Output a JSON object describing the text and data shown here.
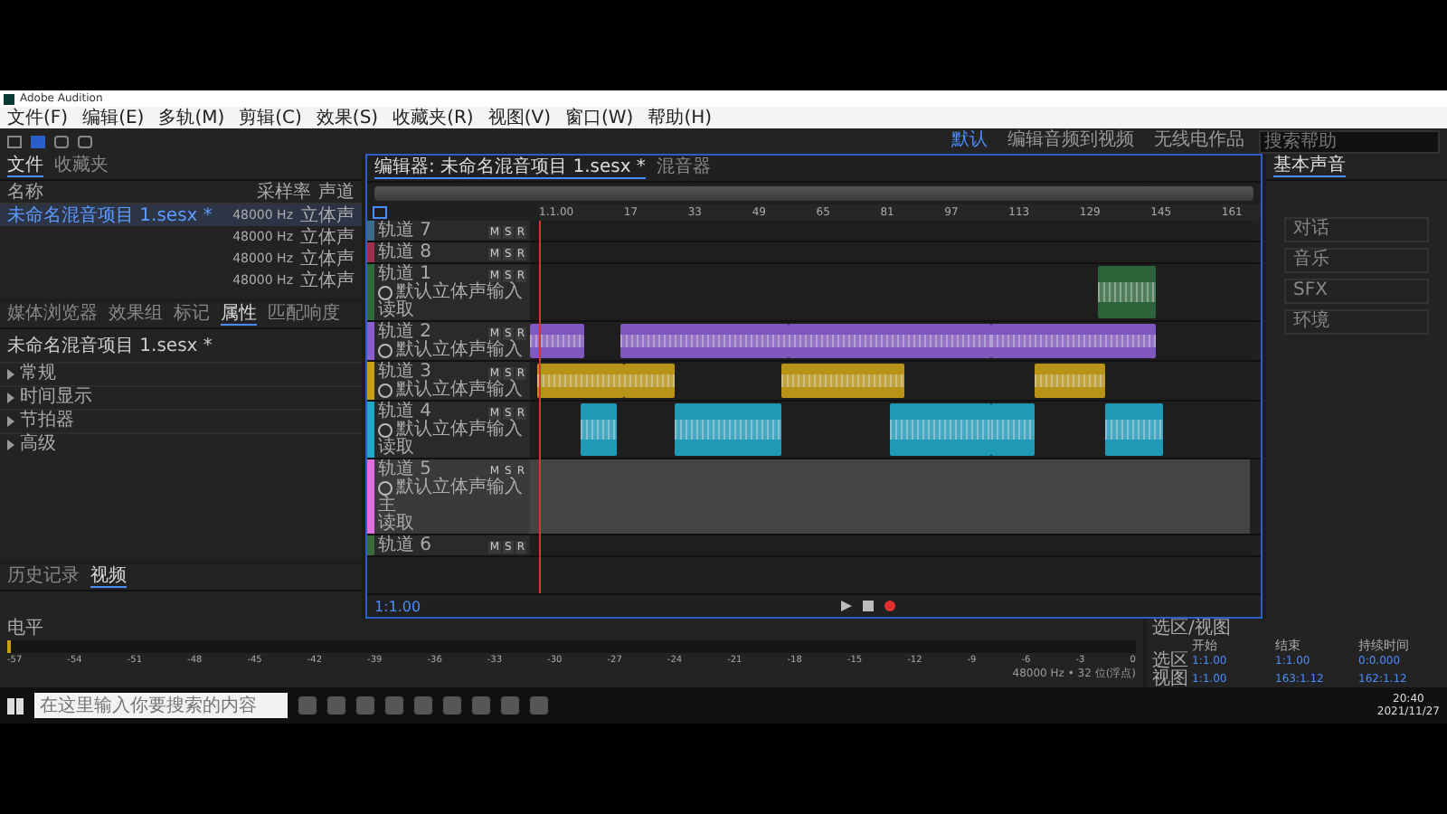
{
  "window": {
    "title": "Adobe Audition"
  },
  "menu": [
    "文件(F)",
    "编辑(E)",
    "多轨(M)",
    "剪辑(C)",
    "效果(S)",
    "收藏夹(R)",
    "视图(V)",
    "窗口(W)",
    "帮助(H)"
  ],
  "workspaces": [
    {
      "label": "默认",
      "selected": true
    },
    {
      "label": "编辑音频到视频",
      "selected": false
    },
    {
      "label": "无线电作品",
      "selected": false
    }
  ],
  "help_search": {
    "placeholder": "搜索帮助"
  },
  "files_panel": {
    "tabs": [
      {
        "label": "文件",
        "selected": true
      },
      {
        "label": "收藏夹",
        "selected": false
      }
    ],
    "columns": [
      "名称",
      "采样率",
      "声道"
    ],
    "rows": [
      {
        "name": "未命名混音项目 1.sesx *",
        "rate": "48000 Hz",
        "channels": "立体声",
        "selected": true
      },
      {
        "rate": "48000 Hz",
        "channels": "立体声",
        "selected": false
      },
      {
        "rate": "48000 Hz",
        "channels": "立体声",
        "selected": false
      },
      {
        "rate": "48000 Hz",
        "channels": "立体声",
        "selected": false
      }
    ]
  },
  "properties_panel": {
    "tabs": [
      {
        "label": "媒体浏览器",
        "selected": false
      },
      {
        "label": "效果组",
        "selected": false
      },
      {
        "label": "标记",
        "selected": false
      },
      {
        "label": "属性",
        "selected": true
      },
      {
        "label": "匹配响度",
        "selected": false
      }
    ],
    "title": "未命名混音项目 1.sesx *",
    "sections": [
      "常规",
      "时间显示",
      "节拍器",
      "高级"
    ]
  },
  "history_panel": {
    "tabs": [
      {
        "label": "历史记录",
        "selected": false
      },
      {
        "label": "视频",
        "selected": true
      }
    ]
  },
  "editor": {
    "tabs": [
      {
        "label": "编辑器: 未命名混音项目 1.sesx *",
        "selected": true
      },
      {
        "label": "混音器",
        "selected": false
      }
    ],
    "ruler": [
      "1.1.00",
      "17",
      "33",
      "49",
      "65",
      "81",
      "97",
      "113",
      "129",
      "145",
      "161"
    ],
    "tracks": [
      {
        "name": "轨道 7",
        "buttons": [
          "M",
          "S",
          "R"
        ],
        "expanded": false,
        "selected": false,
        "color": "#3d6b8a"
      },
      {
        "name": "轨道 8",
        "buttons": [
          "M",
          "S",
          "R"
        ],
        "expanded": false,
        "selected": false,
        "color": "#a03050"
      },
      {
        "name": "轨道 1",
        "buttons": [
          "M",
          "S",
          "R"
        ],
        "expanded": true,
        "selected": false,
        "color": "#2f6b3c",
        "input": "默认立体声输入",
        "mode": "读取"
      },
      {
        "name": "轨道 2",
        "buttons": [
          "M",
          "S",
          "R"
        ],
        "expanded": true,
        "selected": false,
        "color": "#8b5ed0",
        "input": "默认立体声输入"
      },
      {
        "name": "轨道 3",
        "buttons": [
          "M",
          "S",
          "R"
        ],
        "expanded": true,
        "selected": false,
        "color": "#c8a018",
        "input": "默认立体声输入"
      },
      {
        "name": "轨道 4",
        "buttons": [
          "M",
          "S",
          "R"
        ],
        "expanded": true,
        "selected": false,
        "color": "#1fa8c8",
        "input": "默认立体声输入",
        "mode": "读取"
      },
      {
        "name": "轨道 5",
        "buttons": [
          "M",
          "S",
          "R"
        ],
        "expanded": true,
        "selected": true,
        "color": "#e070e0",
        "input": "默认立体声输入",
        "output": "主",
        "mode": "读取"
      },
      {
        "name": "轨道 6",
        "buttons": [
          "M",
          "S",
          "R"
        ],
        "expanded": false,
        "selected": false,
        "color": "#3a6a3a"
      }
    ],
    "time": "1:1.00"
  },
  "essential_sound": {
    "tab": "基本声音",
    "types": [
      "对话",
      "音乐",
      "SFX",
      "环境"
    ]
  },
  "levels": {
    "title": "电平",
    "scale": [
      "-57",
      "-54",
      "-51",
      "-48",
      "-45",
      "-42",
      "-39",
      "-36",
      "-33",
      "-30",
      "-27",
      "-24",
      "-21",
      "-18",
      "-15",
      "-12",
      "-9",
      "-6",
      "-3",
      "0"
    ]
  },
  "status_bar": [
    "48000 Hz • 32 位(浮点)"
  ],
  "selection_view": {
    "title": "选区/视图",
    "columns": [
      "开始",
      "结束",
      "持续时间"
    ],
    "rows": [
      {
        "label": "选区",
        "start": "1:1.00",
        "end": "1:1.00",
        "duration": "0:0.000"
      },
      {
        "label": "视图",
        "start": "1:1.00",
        "end": "163:1.12",
        "duration": "162:1.12"
      }
    ]
  },
  "taskbar": {
    "search_placeholder": "在这里输入你要搜索的内容",
    "time": "20:40",
    "date": "2021/11/27"
  }
}
